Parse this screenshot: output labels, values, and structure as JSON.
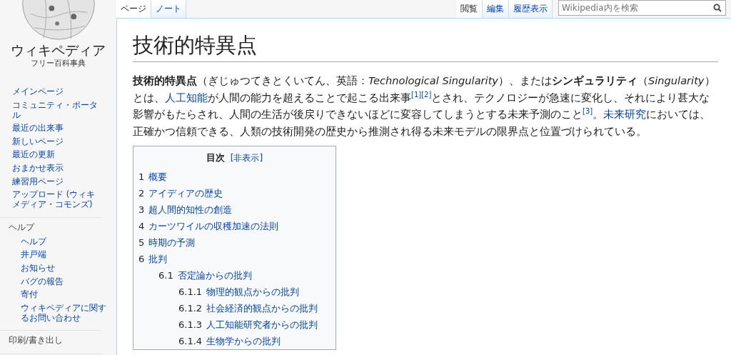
{
  "logo": {
    "name": "ウィキペディア",
    "tagline": "フリー百科事典"
  },
  "sidebar": {
    "nav": [
      "メインページ",
      "コミュニティ・ポータル",
      "最近の出来事",
      "新しいページ",
      "最近の更新",
      "おまかせ表示",
      "練習用ページ",
      "アップロード (ウィキメディア・コモンズ)"
    ],
    "sections": [
      {
        "heading": "ヘルプ",
        "items": [
          "ヘルプ",
          "井戸端",
          "お知らせ",
          "バグの報告",
          "寄付",
          "ウィキペディアに関するお問い合わせ"
        ]
      },
      {
        "heading": "印刷/書き出し"
      }
    ]
  },
  "tabs_left": [
    {
      "label": "ページ",
      "selected": true
    },
    {
      "label": "ノート",
      "selected": false
    }
  ],
  "tabs_right": [
    {
      "label": "閲覧",
      "selected": true
    },
    {
      "label": "編集",
      "selected": false
    },
    {
      "label": "履歴表示",
      "selected": false
    }
  ],
  "search": {
    "placeholder": "Wikipedia内を検索"
  },
  "title": "技術的特異点",
  "intro": [
    {
      "kind": "text",
      "text": "**技術的特異点**（ぎじゅつてきとくいてん、英語：*Technological Singularity*）、または**シンギュラリティ**（*Singularity*）とは、"
    },
    {
      "kind": "link",
      "text": "人工知能"
    },
    {
      "kind": "text",
      "text": "が人間の能力を超えることで起こる出来事"
    },
    {
      "kind": "ref",
      "text": "[1]"
    },
    {
      "kind": "ref",
      "text": "[2]"
    },
    {
      "kind": "text",
      "text": "とされ、テクノロジーが急速に変化し、それにより甚大な影響がもたらされ、人間の生活が後戻りできないほどに変容してしまうとする未来予測のこと"
    },
    {
      "kind": "ref",
      "text": "[3]"
    },
    {
      "kind": "text",
      "text": "。"
    },
    {
      "kind": "link",
      "text": "未来研究"
    },
    {
      "kind": "text",
      "text": "においては、正確かつ信頼できる、人類の技術開発の歴史から推測され得る未来モデルの限界点と位置づけられている。"
    }
  ],
  "toc": {
    "title": "目次",
    "toggle": "[非表示]",
    "items": [
      {
        "number": "1",
        "label": "概要"
      },
      {
        "number": "2",
        "label": "アイディアの歴史"
      },
      {
        "number": "3",
        "label": "超人間的知性の創造"
      },
      {
        "number": "4",
        "label": "カーツワイルの収穫加速の法則"
      },
      {
        "number": "5",
        "label": "時期の予測"
      },
      {
        "number": "6",
        "label": "批判",
        "children": [
          {
            "number": "6.1",
            "label": "否定論からの批判",
            "children": [
              {
                "number": "6.1.1",
                "label": "物理的観点からの批判"
              },
              {
                "number": "6.1.2",
                "label": "社会経済的観点からの批判"
              },
              {
                "number": "6.1.3",
                "label": "人工知能研究者からの批判"
              },
              {
                "number": "6.1.4",
                "label": "生物学からの批判"
              }
            ]
          }
        ]
      }
    ]
  }
}
